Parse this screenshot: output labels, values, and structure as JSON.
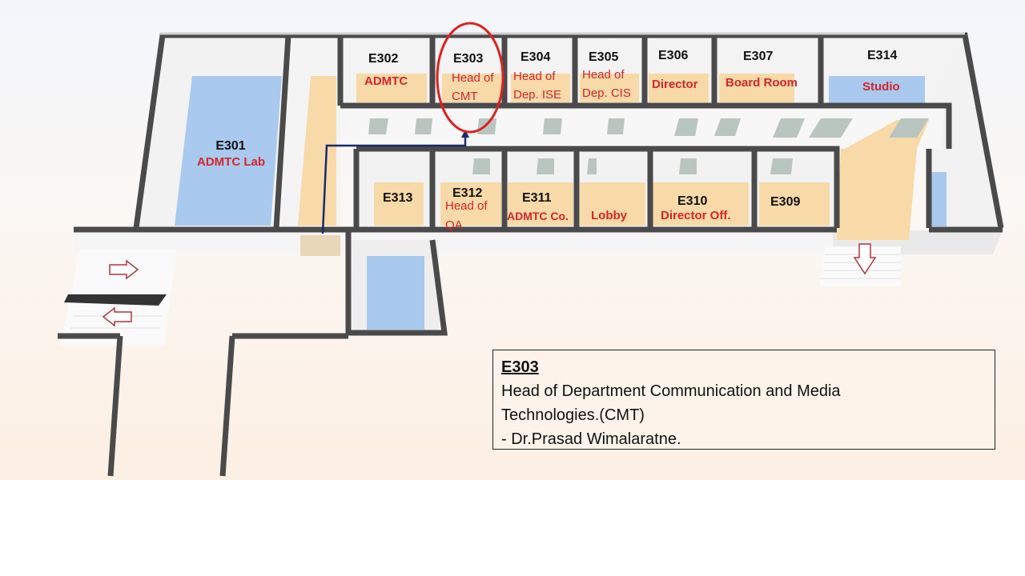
{
  "rooms": {
    "e301": {
      "code": "E301",
      "name": "ADMTC Lab"
    },
    "e302": {
      "code": "E302",
      "name": "ADMTC"
    },
    "e303": {
      "code": "E303",
      "name_line1": "Head of",
      "name_line2": "CMT"
    },
    "e304": {
      "code": "E304",
      "name_line1": "Head of",
      "name_line2": "Dep. ISE"
    },
    "e305": {
      "code": "E305",
      "name_line1": "Head of",
      "name_line2": "Dep. CIS"
    },
    "e306": {
      "code": "E306",
      "name": "Director"
    },
    "e307": {
      "code": "E307",
      "name": "Board Room"
    },
    "e314": {
      "code": "E314",
      "name": "Studio"
    },
    "e313": {
      "code": "E313"
    },
    "e312": {
      "code": "E312",
      "name_line1": "Head of",
      "name_line2": "QA"
    },
    "e311": {
      "code": "E311",
      "name": "ADMTC Co."
    },
    "lobby": {
      "name": "Lobby"
    },
    "e310": {
      "code": "E310",
      "name": "Director Off."
    },
    "e309": {
      "code": "E309"
    }
  },
  "info": {
    "title": "E303",
    "line1": "Head of Department Communication and Media",
    "line2": "Technologies.(CMT)",
    "line3": "- Dr.Prasad Wimalaratne."
  },
  "highlight": {
    "room": "E303",
    "color": "#e02020"
  },
  "route_color": "#1a2a6c",
  "colors": {
    "wall": "#4a4a4a",
    "floor": "#f8d9a8",
    "blue_room": "#a9c9ee",
    "highlight_text": "#d4262a"
  }
}
